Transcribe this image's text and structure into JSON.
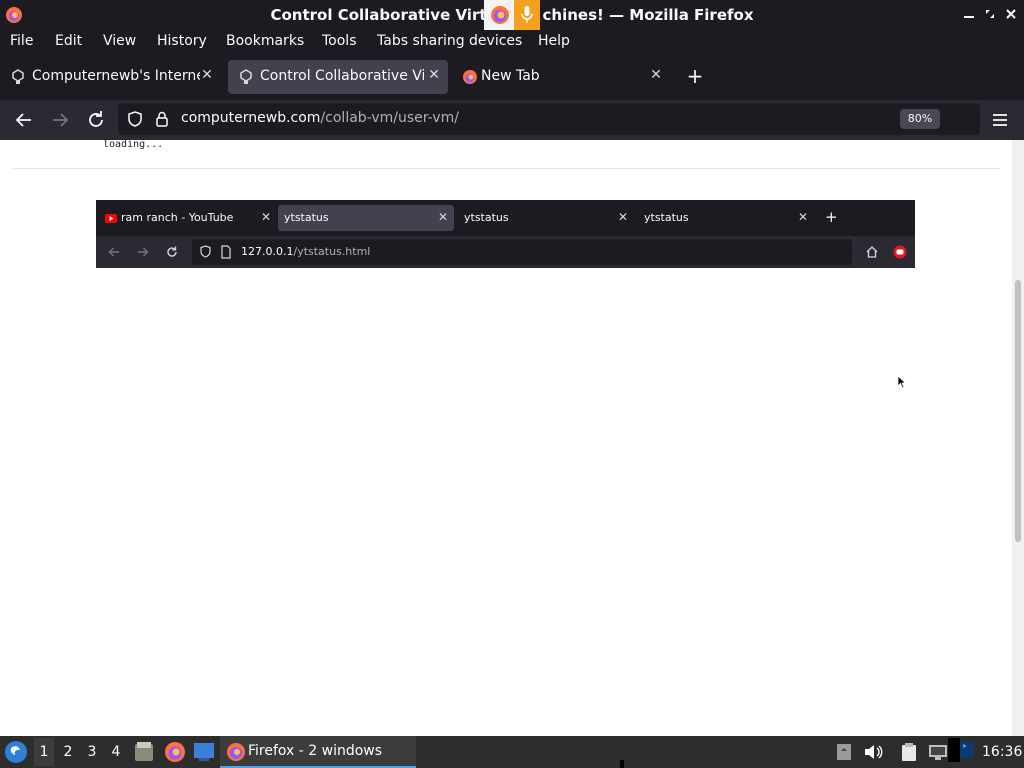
{
  "window": {
    "title": "Control Collaborative Virt",
    "title_tail": "chines! — Mozilla Firefox",
    "minimize_icon": "minimize-icon",
    "maximize_icon": "maximize-icon",
    "close_icon": "close-icon"
  },
  "menu": [
    "File",
    "Edit",
    "View",
    "History",
    "Bookmarks",
    "Tools",
    "Tabs sharing devices",
    "Help"
  ],
  "tabs": [
    {
      "label": "Computernewb's Interne",
      "icon": "computernewb-icon",
      "active": false
    },
    {
      "label": "Control Collaborative Virt",
      "icon": "computernewb-icon",
      "active": true
    },
    {
      "label": "New Tab",
      "icon": "firefox-icon",
      "active": false
    }
  ],
  "navbar": {
    "url_host": "computernewb.com",
    "url_path": "/collab-vm/user-vm/",
    "zoom": "80%"
  },
  "vm": {
    "tabs": [
      {
        "label": "ram ranch - YouTube",
        "active": false
      },
      {
        "label": "ytstatus",
        "active": true
      },
      {
        "label": "ytstatus",
        "active": false
      },
      {
        "label": "ytstatus",
        "active": false
      }
    ],
    "url_host": "127.0.0.1",
    "url_path": "/ytstatus.html",
    "loading_text": "loading..."
  },
  "taskbar": {
    "workspaces": [
      "1",
      "2",
      "3",
      "4"
    ],
    "task_label": "Firefox - 2 windows",
    "clock": "16:36"
  },
  "colors": {
    "chrome_dark": "#1c1b22",
    "toolbar": "#2b2a33",
    "active_tab": "#42414d",
    "accent_orange": "#f6a020",
    "taskbar_accent": "#4aa3e8"
  }
}
